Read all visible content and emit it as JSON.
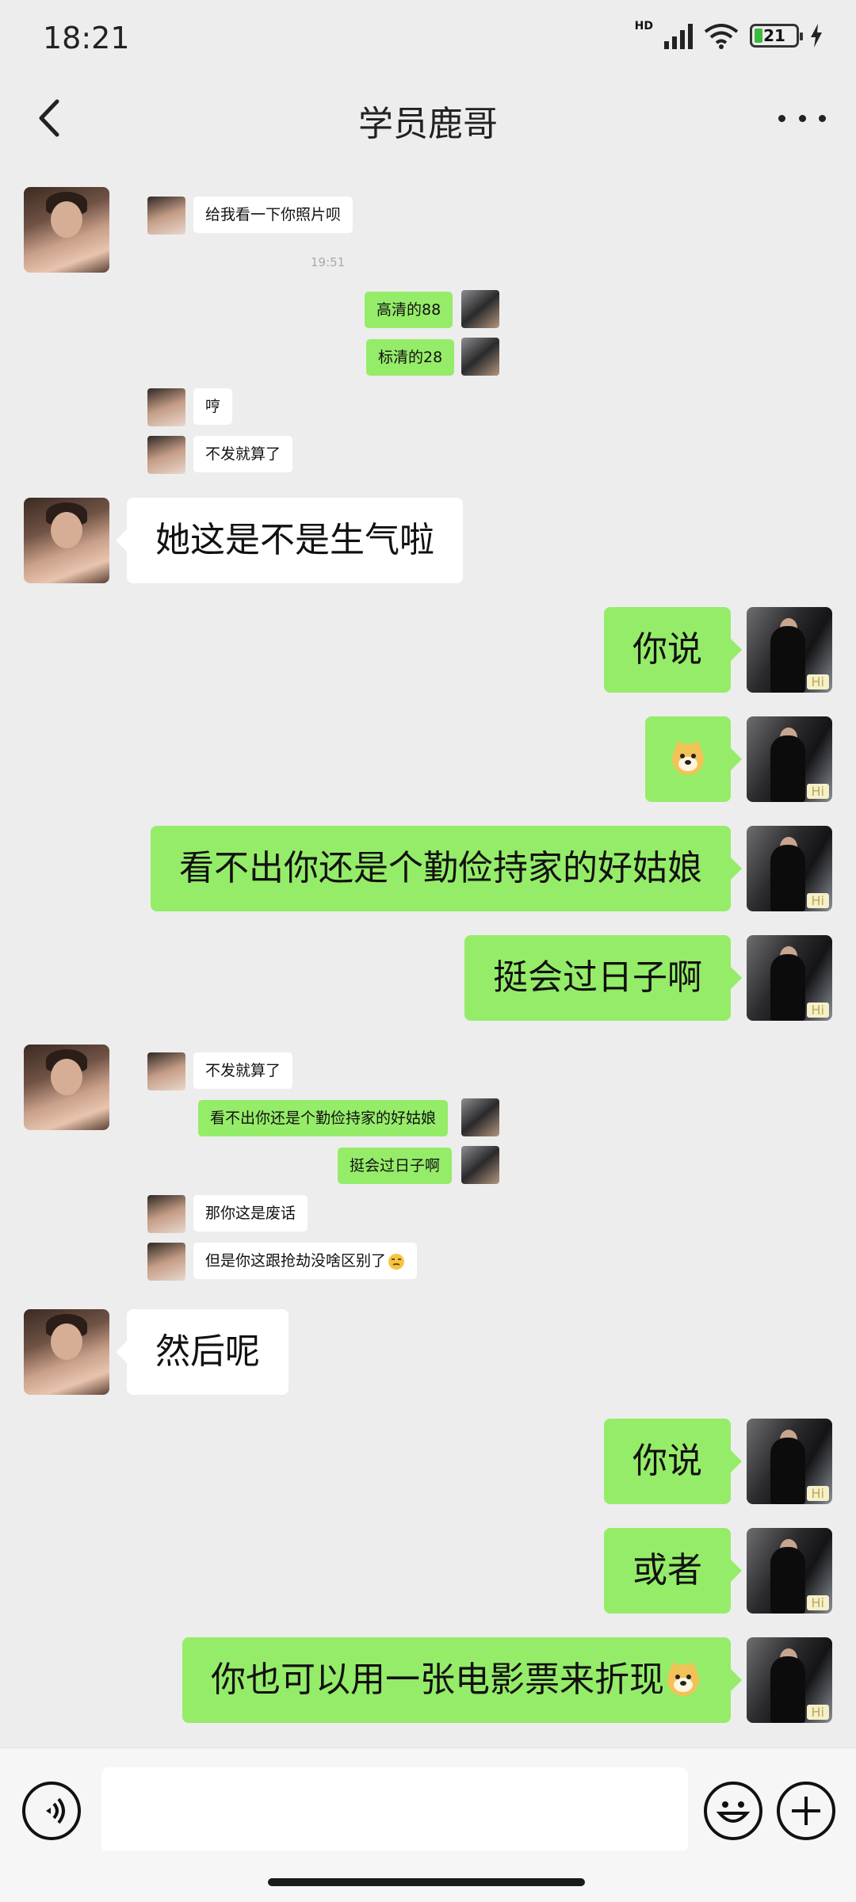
{
  "status": {
    "time": "18:21",
    "network": "HD",
    "battery": "21"
  },
  "header": {
    "title": "学员鹿哥"
  },
  "screenshot": {
    "m1": "给我看一下你照片呗",
    "time": "19:51",
    "m2": "高清的88",
    "m3": "标清的28",
    "m4": "哼",
    "m5": "不发就算了"
  },
  "messages": {
    "in1": "她这是不是生气啦",
    "out1": "你说",
    "out3": "看不出你还是个勤俭持家的好姑娘",
    "out4": "挺会过日子啊",
    "in2": "然后呢",
    "out5": "你说",
    "out6": "或者",
    "out7": "你也可以用一张电影票来折现"
  },
  "screenshot2": {
    "m1": "不发就算了",
    "m2": "看不出你还是个勤俭持家的好姑娘",
    "m3": "挺会过日子啊",
    "m4": "那你这是废话",
    "m5": "但是你这跟抢劫没啥区别了"
  },
  "avatar_badge": "Hi",
  "icons": {
    "back": "chevron-left-icon",
    "more": "more-dots-icon",
    "voice": "voice-icon",
    "emoji": "smile-icon",
    "plus": "plus-icon"
  },
  "colors": {
    "outgoing": "#95ec69",
    "incoming": "#ffffff",
    "background": "#ededed"
  }
}
